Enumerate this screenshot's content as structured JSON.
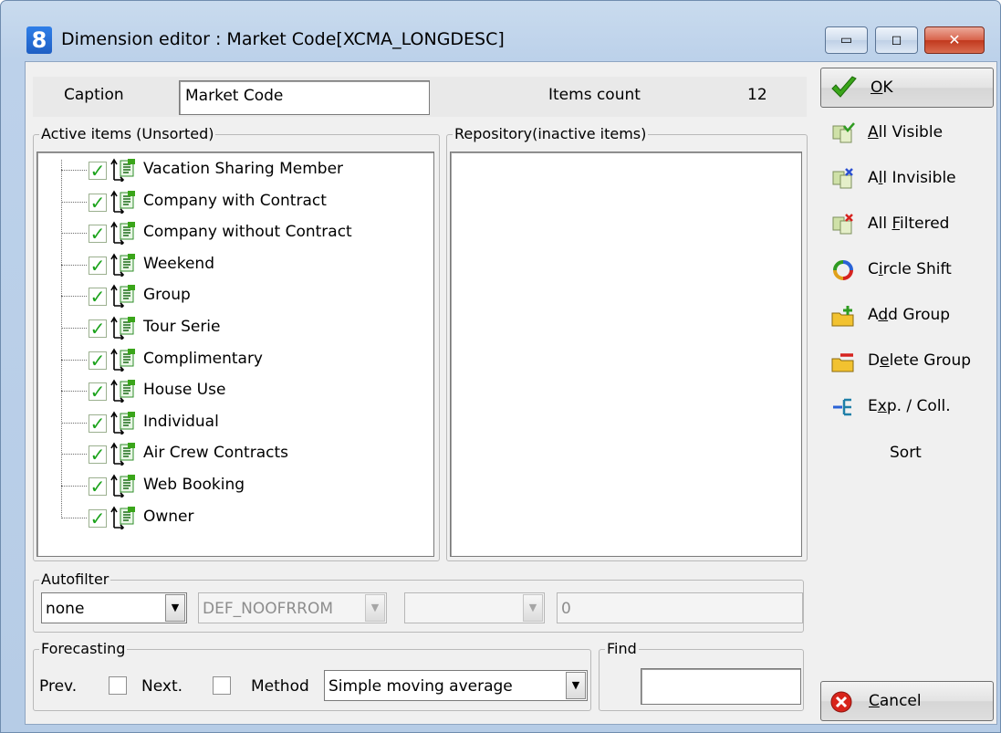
{
  "window": {
    "title": "Dimension editor : Market Code[XCMA_LONGDESC]",
    "app_icon_glyph": "8",
    "min_glyph": "▭",
    "max_glyph": "◻",
    "close_glyph": "✕"
  },
  "header": {
    "caption_label": "Caption",
    "caption_value": "Market Code",
    "items_count_label": "Items count",
    "items_count_value": "12"
  },
  "active": {
    "legend": "Active items (Unsorted)",
    "items": [
      "Vacation Sharing Member",
      "Company with Contract",
      "Company without Contract",
      "Weekend",
      "Group",
      "Tour Serie",
      "Complimentary",
      "House Use",
      "Individual",
      "Air Crew Contracts",
      "Web Booking",
      "Owner"
    ]
  },
  "repository": {
    "legend": "Repository(inactive items)"
  },
  "autofilter": {
    "legend": "Autofilter",
    "mode": "none",
    "field": "DEF_NOOFRROM",
    "operator": "",
    "value": "0"
  },
  "forecasting": {
    "legend": "Forecasting",
    "prev_label": "Prev.",
    "next_label": "Next.",
    "method_label": "Method",
    "method_value": "Simple moving average"
  },
  "find": {
    "legend": "Find",
    "value": ""
  },
  "side": {
    "ok": {
      "accel": "O",
      "rest": "K"
    },
    "all_visible": {
      "accel": "A",
      "rest": "ll Visible"
    },
    "all_invisible": {
      "pre": "A",
      "accel": "l",
      "rest": "l Invisible"
    },
    "all_filtered": {
      "pre": "All ",
      "accel": "F",
      "rest": "iltered"
    },
    "circle_shift": {
      "pre": "C",
      "accel": "i",
      "rest": "rcle Shift"
    },
    "add_group": {
      "pre": "A",
      "accel": "d",
      "rest": "d Group"
    },
    "delete_group": {
      "pre": "D",
      "accel": "e",
      "rest": "lete Group"
    },
    "exp_coll": {
      "pre": "E",
      "accel": "x",
      "rest": "p. / Coll."
    },
    "sort": "Sort",
    "cancel": {
      "accel": "C",
      "rest": "ancel"
    }
  },
  "colors": {
    "check_green": "#1ca31c",
    "ok_green": "#3aa51a",
    "cancel_red": "#d8241b",
    "titlebar": "#b6cce6"
  },
  "icons": {
    "app": "app-8-icon",
    "item": "dimension-item-icon",
    "ok": "green-checkmark-icon",
    "cancel": "red-x-icon"
  }
}
